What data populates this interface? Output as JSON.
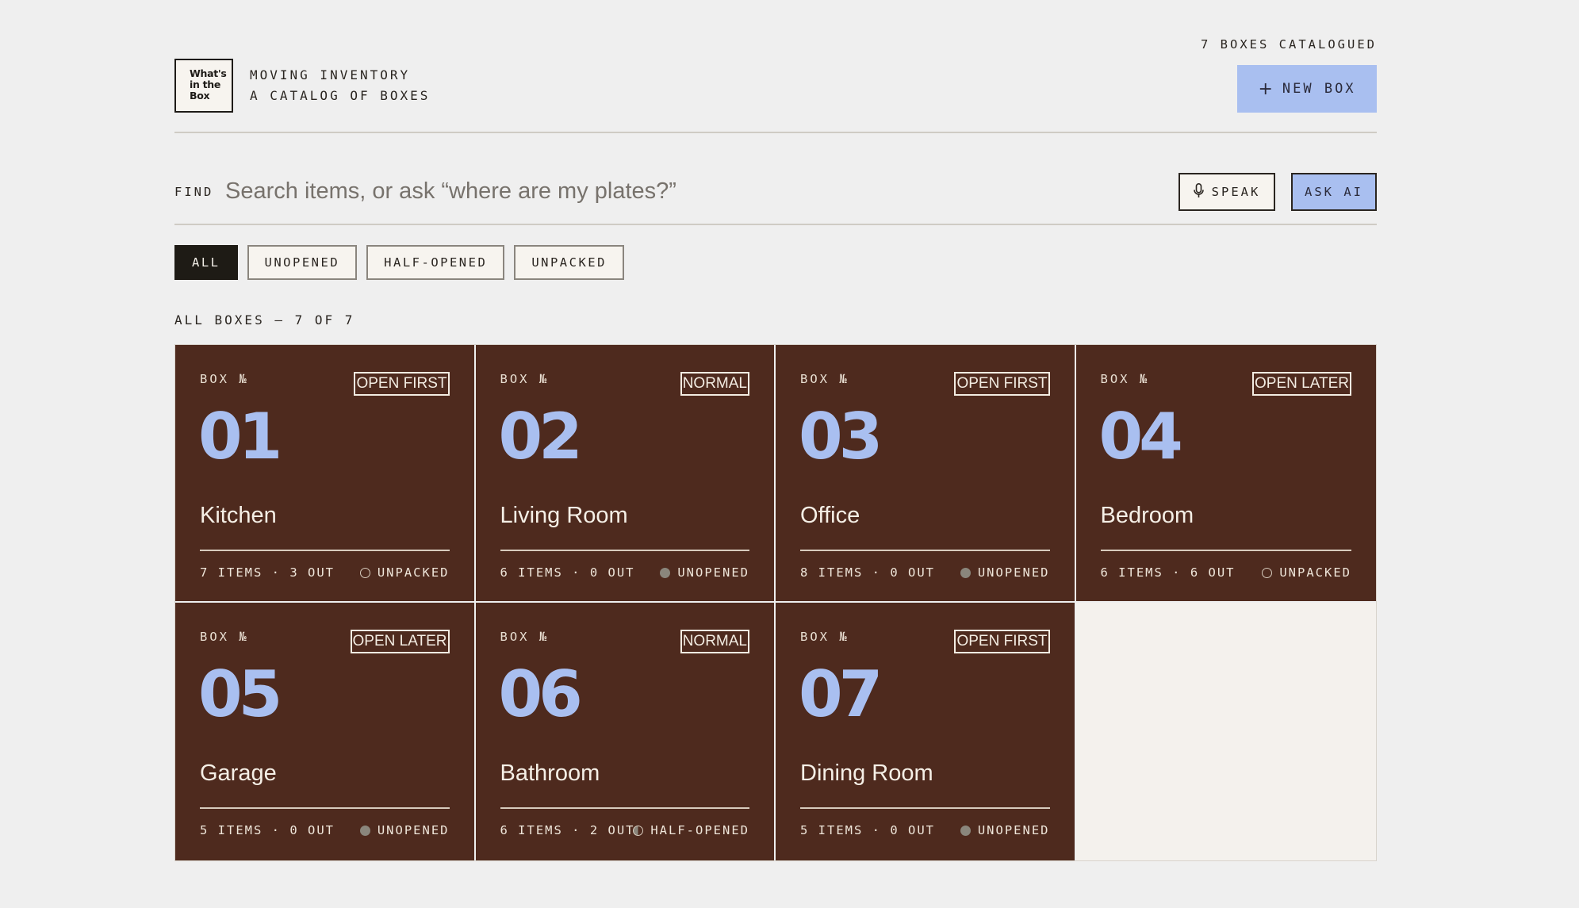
{
  "header": {
    "logo_lines": [
      "What's",
      "in the",
      "Box"
    ],
    "brand_line1": "MOVING INVENTORY",
    "brand_line2": "A CATALOG OF BOXES",
    "count_label": "7 BOXES CATALOGUED",
    "new_box_icon": "plus-icon",
    "new_box_label": "NEW BOX"
  },
  "search": {
    "label": "FIND",
    "placeholder": "Search items, or ask “where are my plates?”",
    "value": "",
    "speak_icon": "microphone-icon",
    "speak_label": "SPEAK",
    "ask_label": "ASK AI"
  },
  "filters": [
    {
      "label": "ALL",
      "active": true
    },
    {
      "label": "UNOPENED",
      "active": false
    },
    {
      "label": "HALF-OPENED",
      "active": false
    },
    {
      "label": "UNPACKED",
      "active": false
    }
  ],
  "section_title": "ALL BOXES — 7 OF 7",
  "boxes": [
    {
      "box_label": "BOX №",
      "number": "01",
      "priority": "OPEN FIRST",
      "room": "Kitchen",
      "stats": "7 ITEMS · 3 OUT",
      "status": "UNPACKED",
      "status_type": "unpacked"
    },
    {
      "box_label": "BOX №",
      "number": "02",
      "priority": "NORMAL",
      "room": "Living Room",
      "stats": "6 ITEMS · 0 OUT",
      "status": "UNOPENED",
      "status_type": "unopened"
    },
    {
      "box_label": "BOX №",
      "number": "03",
      "priority": "OPEN FIRST",
      "room": "Office",
      "stats": "8 ITEMS · 0 OUT",
      "status": "UNOPENED",
      "status_type": "unopened"
    },
    {
      "box_label": "BOX №",
      "number": "04",
      "priority": "OPEN LATER",
      "room": "Bedroom",
      "stats": "6 ITEMS · 6 OUT",
      "status": "UNPACKED",
      "status_type": "unpacked"
    },
    {
      "box_label": "BOX №",
      "number": "05",
      "priority": "OPEN LATER",
      "room": "Garage",
      "stats": "5 ITEMS · 0 OUT",
      "status": "UNOPENED",
      "status_type": "unopened"
    },
    {
      "box_label": "BOX №",
      "number": "06",
      "priority": "NORMAL",
      "room": "Bathroom",
      "stats": "6 ITEMS · 2 OUT",
      "status": "HALF-OPENED",
      "status_type": "half"
    },
    {
      "box_label": "BOX №",
      "number": "07",
      "priority": "OPEN FIRST",
      "room": "Dining Room",
      "stats": "5 ITEMS · 0 OUT",
      "status": "UNOPENED",
      "status_type": "unopened"
    }
  ],
  "colors": {
    "background": "#efefef",
    "card": "#4e2a1e",
    "accent": "#a9bff0",
    "ink": "#1e1b15"
  }
}
